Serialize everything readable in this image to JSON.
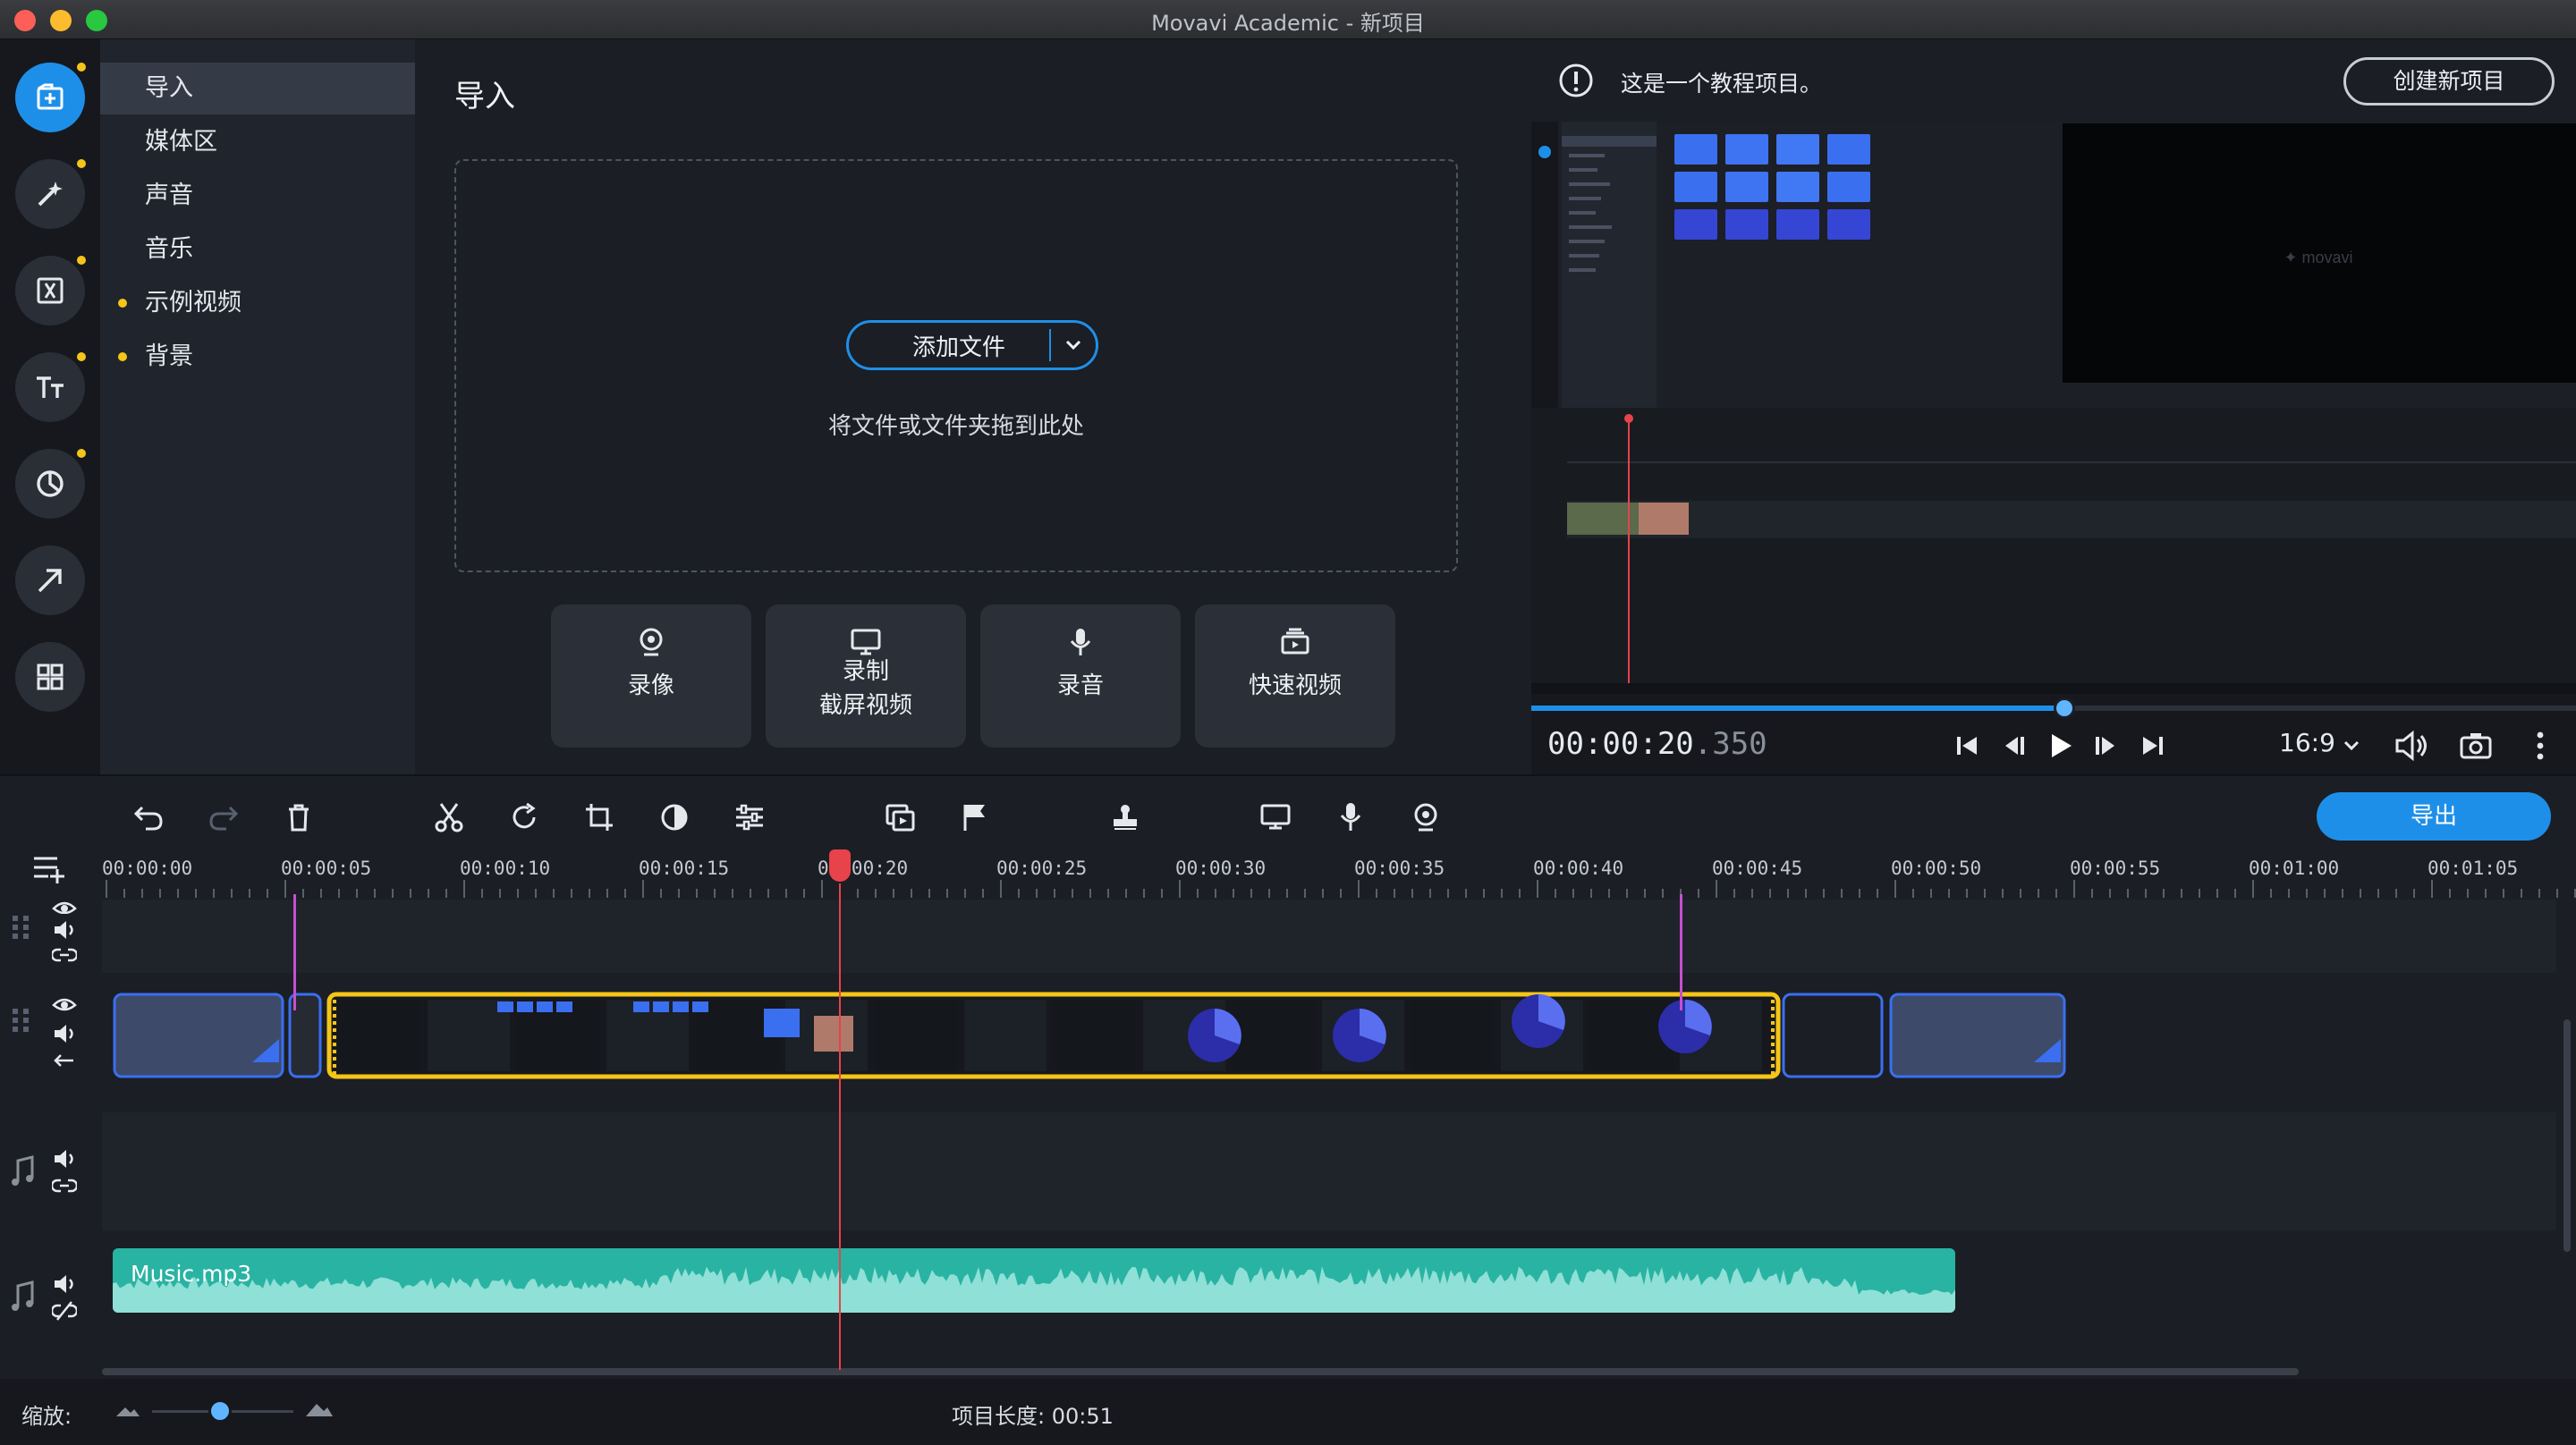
{
  "window": {
    "title": "Movavi Academic - 新项目"
  },
  "colors": {
    "accent": "#1e8fe8",
    "clip_selected": "#f5c518",
    "audio": "#29b3a3",
    "playhead": "#e8424b",
    "marker": "#c74fd0"
  },
  "left_tools": [
    {
      "icon": "import-icon",
      "active": true
    },
    {
      "icon": "magic-wand-icon"
    },
    {
      "icon": "transitions-icon"
    },
    {
      "icon": "titles-icon"
    },
    {
      "icon": "stickers-icon"
    },
    {
      "icon": "callouts-icon"
    },
    {
      "icon": "more-tools-icon"
    }
  ],
  "nav": {
    "items": [
      {
        "label": "导入",
        "selected": true
      },
      {
        "label": "媒体区"
      },
      {
        "label": "声音"
      },
      {
        "label": "音乐"
      },
      {
        "label": "示例视频",
        "new": true
      },
      {
        "label": "背景",
        "new": true
      }
    ]
  },
  "import": {
    "title": "导入",
    "add_files": "添加文件",
    "drop_hint": "将文件或文件夹拖到此处",
    "capture": [
      {
        "icon": "webcam-icon",
        "line1": "录像",
        "line2": ""
      },
      {
        "icon": "screen-record-icon",
        "line1": "录制",
        "line2": "截屏视频"
      },
      {
        "icon": "microphone-icon",
        "line1": "录音",
        "line2": ""
      },
      {
        "icon": "quick-video-icon",
        "line1": "快速视频",
        "line2": ""
      }
    ]
  },
  "preview": {
    "notice": "这是一个教程项目。",
    "new_project": "创建新项目",
    "time_main": "00:00:20",
    "time_ms": ".350",
    "aspect": "16:9",
    "progress": 0.51
  },
  "timeline": {
    "export": "导出",
    "ticks": [
      "00:00:00",
      "00:00:05",
      "00:00:10",
      "00:00:15",
      "00:00:20",
      "00:00:25",
      "00:00:30",
      "00:00:35",
      "00:00:40",
      "00:00:45",
      "00:00:50",
      "00:00:55",
      "00:01:00",
      "00:01:05"
    ],
    "audio_clip": "Music.mp3",
    "zoom_label": "缩放:",
    "project_length": "项目长度: 00:51",
    "zoom": 0.48
  }
}
